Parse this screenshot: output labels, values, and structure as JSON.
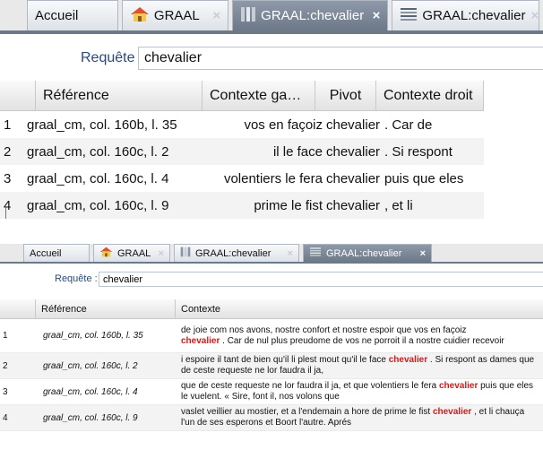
{
  "top_view": {
    "tabs": [
      {
        "label": "Accueil",
        "icon": "",
        "close": "",
        "active": false
      },
      {
        "label": "GRAAL",
        "icon": "home-icon",
        "close": "×",
        "active": false
      },
      {
        "label": "GRAAL:chevalier",
        "icon": "concordance-icon",
        "close": "×",
        "active": true
      },
      {
        "label": "GRAAL:chevalier",
        "icon": "text-icon",
        "close": "×",
        "active": false
      }
    ],
    "query": {
      "label": "Requête :",
      "value": "chevalier"
    },
    "columns": [
      "",
      "Référence",
      "Contexte ga…",
      "Pivot",
      "Contexte droit"
    ],
    "rows": [
      {
        "num": "1",
        "ref": "graal_cm, col. 160b, l. 35",
        "left": "vos en façoiz",
        "pivot": "chevalier",
        "right": ". Car de"
      },
      {
        "num": "2",
        "ref": "graal_cm, col. 160c, l. 2",
        "left": "il le face",
        "pivot": "chevalier",
        "right": ". Si respont"
      },
      {
        "num": "3",
        "ref": "graal_cm, col. 160c, l. 4",
        "left": "volentiers le fera",
        "pivot": "chevalier",
        "right": "puis que eles"
      },
      {
        "num": "4",
        "ref": "graal_cm, col. 160c, l. 9",
        "left": "prime le fist",
        "pivot": "chevalier",
        "right": ", et li"
      }
    ]
  },
  "bottom_view": {
    "tabs": [
      {
        "label": "Accueil",
        "icon": "",
        "close": "",
        "active": false
      },
      {
        "label": "GRAAL",
        "icon": "home-icon",
        "close": "×",
        "active": false
      },
      {
        "label": "GRAAL:chevalier",
        "icon": "concordance-icon",
        "close": "×",
        "active": false
      },
      {
        "label": "GRAAL:chevalier",
        "icon": "text-icon",
        "close": "×",
        "active": true
      }
    ],
    "query": {
      "label": "Requête :",
      "value": "chevalier"
    },
    "columns": [
      "",
      "Référence",
      "Contexte"
    ],
    "rows": [
      {
        "num": "1",
        "ref": "graal_cm, col. 160b, l. 35",
        "before": "de joie com nos avons, nostre confort et nostre espoir que vos en façoiz",
        "pivot": "chevalier",
        "after": ". Car de nul plus preudome de vos ne porroit il a nostre cuidier recevoir"
      },
      {
        "num": "2",
        "ref": "graal_cm, col. 160c, l. 2",
        "before": "i espoire il tant de bien qu'il li plest mout qu'il le face",
        "pivot": "chevalier",
        "after": ". Si respont as dames que de ceste requeste ne lor faudra il ja,"
      },
      {
        "num": "3",
        "ref": "graal_cm, col. 160c, l. 4",
        "before": "que de ceste requeste ne lor faudra il ja, et que volentiers le fera",
        "pivot": "chevalier",
        "after": "puis que eles le vuelent. « Sire, font il, nos volons que"
      },
      {
        "num": "4",
        "ref": "graal_cm, col. 160c, l. 9",
        "before": "vaslet veillier au mostier, et a l'endemain a hore de prime le fist",
        "pivot": "chevalier",
        "after": ", et li chauça l'un de ses esperons et Boort l'autre. Aprés"
      }
    ]
  },
  "colors": {
    "active_tab": "#7a8696",
    "pivot_highlight": "#d21a1a",
    "label_blue": "#2b4a7a"
  }
}
